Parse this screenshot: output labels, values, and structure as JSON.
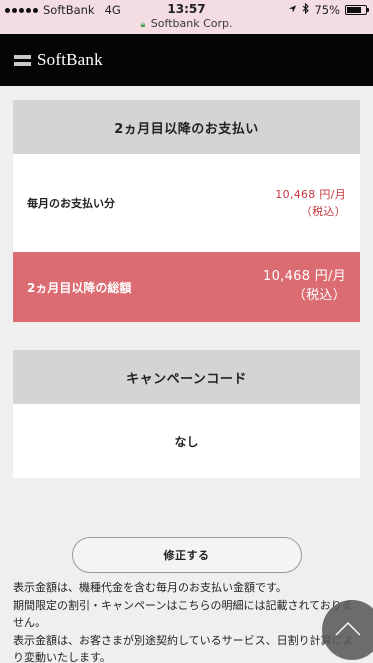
{
  "status_bar": {
    "carrier": "SoftBank",
    "network": "4G",
    "time": "13:57",
    "url_host": "Softbank Corp.",
    "battery": "75%",
    "battery_level": 0.75
  },
  "header": {
    "logo_text": "SoftBank"
  },
  "payment_panel": {
    "title": "2ヵ月目以降のお支払い",
    "monthly": {
      "label": "毎月のお支払い分",
      "amount": "10,468 円/月",
      "tax": "（税込）"
    },
    "total": {
      "label": "2ヵ月目以降の総額",
      "amount": "10,468 円/月",
      "tax": "（税込）"
    }
  },
  "campaign_panel": {
    "title": "キャンペーンコード",
    "value": "なし"
  },
  "edit_button_label": "修正する",
  "notes": [
    "表示金額は、機種代金を含む毎月のお支払い金額です。",
    "期間限定の割引・キャンペーンはこちらの明細には記載されておりません。",
    "表示金額は、お客さまが別途契約しているサービス、日割り計算により変動いたします。"
  ],
  "colors": {
    "status_bar_bg": "#f4dde2",
    "header_bg": "#050505",
    "panel_head_bg": "#d4d4d4",
    "total_row_bg": "#db6c72",
    "price_red": "#c4353f"
  },
  "icons": [
    "signal-icon",
    "lock-icon",
    "location-icon",
    "bluetooth-icon",
    "battery-icon",
    "chevron-up-icon"
  ]
}
